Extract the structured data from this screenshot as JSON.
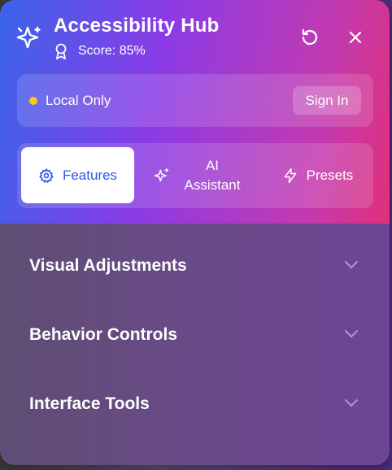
{
  "colors": {
    "header_gradient": [
      "#3b64ea",
      "#8b3be6",
      "#c33ab0",
      "#e0307a"
    ],
    "body_bg": "#6a4a88",
    "status_dot": "#facc15",
    "active_tab_text": "#2b5be0"
  },
  "header": {
    "title": "Accessibility Hub",
    "score_label": "Score: 85%",
    "brand_icon": "sparkle-accessibility-icon",
    "reset_icon": "rotate-ccw-icon",
    "close_icon": "close-icon"
  },
  "status": {
    "text": "Local Only",
    "sign_in_label": "Sign In"
  },
  "tabs": [
    {
      "label": "Features",
      "icon": "gear-icon",
      "active": true
    },
    {
      "label": "AI\nAssistant",
      "label_line1": "AI",
      "label_line2": "Assistant",
      "icon": "sparkles-icon",
      "active": false
    },
    {
      "label": "Presets",
      "icon": "lightning-icon",
      "active": false
    }
  ],
  "sections": [
    {
      "title": "Visual Adjustments",
      "expanded": false
    },
    {
      "title": "Behavior Controls",
      "expanded": false
    },
    {
      "title": "Interface Tools",
      "expanded": false
    }
  ]
}
